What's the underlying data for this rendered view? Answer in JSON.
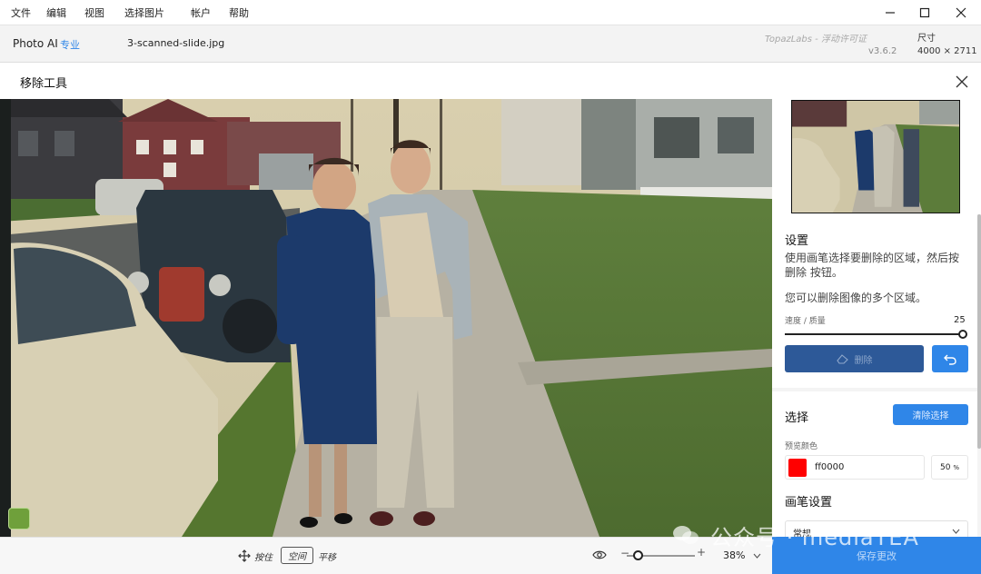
{
  "menu": {
    "items": [
      "文件",
      "编辑",
      "视图",
      "选择图片",
      "帐户",
      "帮助"
    ]
  },
  "window_controls": [
    "minimize-icon",
    "maximize-icon",
    "close-icon"
  ],
  "infobar": {
    "app_name": "Photo AI",
    "app_tier": "专业",
    "filename": "3-scanned-slide.jpg",
    "license": "TopazLabs - 浮动许可证",
    "version": "v3.6.2",
    "size_label": "尺寸",
    "size_value": "4000 × 2711"
  },
  "tool": {
    "title": "移除工具"
  },
  "panel": {
    "settings_title": "设置",
    "settings_desc": "使用画笔选择要删除的区域，然后按 删除 按钮。",
    "settings_desc2": "您可以删除图像的多个区域。",
    "slider_label": "速度 / 质量",
    "slider_value": "25",
    "slider_level": 1.0,
    "remove_label": "删除",
    "select_title": "选择",
    "clear_label": "清除选择",
    "preview_color_label": "预览颜色",
    "preview_color_hex": "ff0000",
    "preview_color": "#ff0000",
    "preview_opacity": "50",
    "preview_opacity_unit": "%",
    "brush_title": "画笔设置",
    "brush_mode": "常规"
  },
  "statusbar": {
    "hint_prefix": "按住",
    "hint_key": "空间",
    "hint_suffix": "平移",
    "zoom_value": "38%",
    "zoom_level": 0.38
  },
  "save_label": "保存更改",
  "watermark": "公众号 · mediaTEA",
  "colors": {
    "accent": "#2f86e8",
    "remove_button": "#2d5998",
    "swatch": "#ff0000"
  }
}
